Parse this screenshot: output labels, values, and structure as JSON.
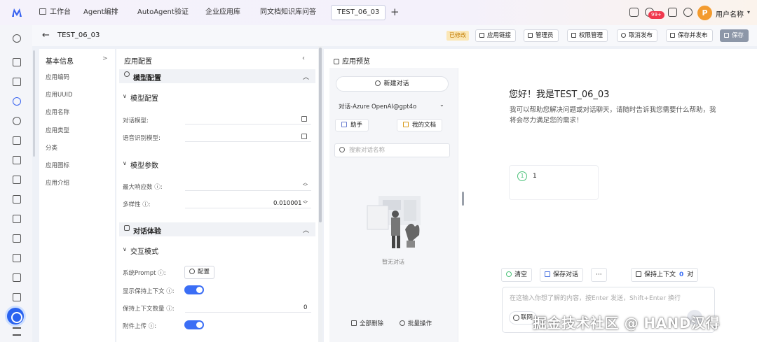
{
  "tabs": [
    "工作台",
    "Agent编排",
    "AutoAgent验证",
    "企业应用库",
    "同文档知识库问答",
    "TEST_06_03"
  ],
  "topbar": {
    "badge": "99+",
    "avatar_letter": "P",
    "user_name": "用户名称"
  },
  "header": {
    "title": "TEST_06_03",
    "modified": "已修改",
    "buttons": {
      "app_link": "应用链接",
      "admin": "管理员",
      "permission": "权限管理",
      "unpublish": "取消发布",
      "save_publish": "保存并发布",
      "save": "保存"
    }
  },
  "info": {
    "title": "基本信息",
    "items": [
      "应用编码",
      "应用UUID",
      "应用名称",
      "应用类型",
      "分类",
      "应用图标",
      "应用介绍"
    ]
  },
  "config": {
    "title": "应用配置",
    "model_section": "模型配置",
    "model_sub": "模型配置",
    "chat_model": "对话模型:",
    "voice_model": "语音识别模型:",
    "param_sub": "模型参数",
    "max_reply": "最大响应数 ⓘ:",
    "diversity": "多样性 ⓘ:",
    "diversity_value": "0.010001",
    "exp_section": "对话体验",
    "interact_sub": "交互模式",
    "system_prompt": "系统Prompt ⓘ:",
    "config_btn": "配置",
    "show_context": "显示保持上下文 ⓘ:",
    "context_count": "保持上下文数量 ⓘ:",
    "context_count_value": "0",
    "attach_upload": "附件上传 ⓘ:",
    "show_context_on": true,
    "attach_upload_on": true
  },
  "preview": {
    "title": "应用预览",
    "new_chat": "新建对话",
    "model": "对话-Azure OpenAI@gpt4o",
    "assistant": "助手",
    "my_docs": "我的文档",
    "search_placeholder": "搜索对话名称",
    "empty": "暂无对话",
    "delete_all": "全部删除",
    "batch": "批量操作"
  },
  "chat": {
    "greeting": "您好！我是TEST_06_03",
    "desc": "我可以帮助您解决问题或对话聊天，请随时告诉我您需要什么帮助，我将会尽力满足您的需求！",
    "msg_index": "1",
    "msg_text": "1",
    "clear": "清空",
    "save_chat": "保存对话",
    "more": "···",
    "keep_context": "保持上下文",
    "keep_count": "0",
    "keep_unit": "对",
    "input_placeholder": "在这输入你想了解的内容，按Enter 发送，Shift+Enter 换行",
    "network": "联网"
  },
  "watermark": "掘金技术社区 @ HAND汉得"
}
